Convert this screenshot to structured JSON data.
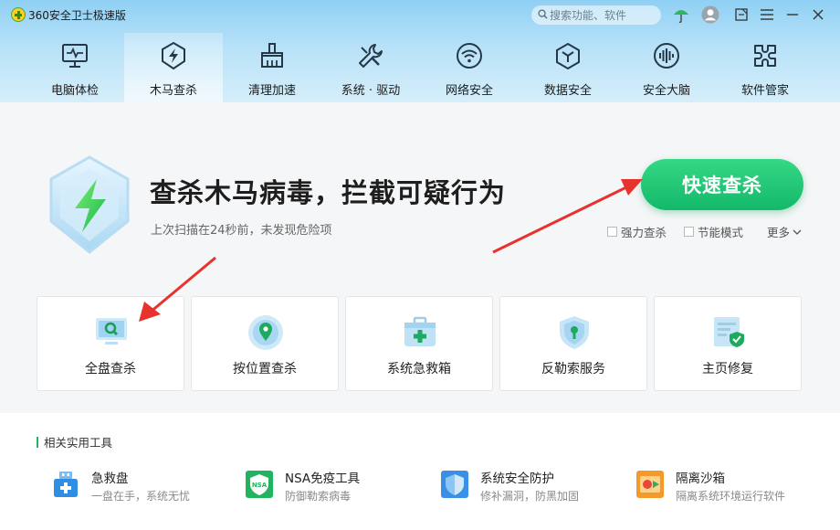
{
  "app": {
    "title": "360安全卫士极速版"
  },
  "search": {
    "placeholder": "搜索功能、软件"
  },
  "nav": {
    "tabs": [
      {
        "label": "电脑体检",
        "icon": "monitor-pulse-icon"
      },
      {
        "label": "木马查杀",
        "icon": "shield-bolt-icon"
      },
      {
        "label": "清理加速",
        "icon": "broom-icon"
      },
      {
        "label": "系统 · 驱动",
        "icon": "wrench-icon"
      },
      {
        "label": "网络安全",
        "icon": "wifi-icon"
      },
      {
        "label": "数据安全",
        "icon": "hexagon-icon"
      },
      {
        "label": "安全大脑",
        "icon": "brain-wave-icon"
      },
      {
        "label": "软件管家",
        "icon": "puzzle-icon"
      }
    ],
    "active_index": 1
  },
  "main": {
    "headline": "查杀木马病毒，拦截可疑行为",
    "subtext": "上次扫描在24秒前，未发现危险项",
    "quick_scan_label": "快速查杀",
    "options": {
      "power_scan": "强力查杀",
      "power_save": "节能模式",
      "more": "更多"
    }
  },
  "cards": [
    {
      "label": "全盘查杀",
      "icon": "monitor-search-icon"
    },
    {
      "label": "按位置查杀",
      "icon": "location-pin-icon"
    },
    {
      "label": "系统急救箱",
      "icon": "first-aid-kit-icon"
    },
    {
      "label": "反勒索服务",
      "icon": "shield-keyhole-icon"
    },
    {
      "label": "主页修复",
      "icon": "page-shield-icon"
    }
  ],
  "tools": {
    "title": "相关实用工具",
    "items": [
      {
        "name": "急救盘",
        "desc": "一盘在手，系统无忧",
        "icon": "usb-drive-icon"
      },
      {
        "name": "NSA免疫工具",
        "desc": "防御勒索病毒",
        "icon": "nsa-shield-icon",
        "badge": "NSA"
      },
      {
        "name": "系统安全防护",
        "desc": "修补漏洞，防黑加固",
        "icon": "blue-shield-icon"
      },
      {
        "name": "隔离沙箱",
        "desc": "隔离系统环境运行软件",
        "icon": "sandbox-icon"
      }
    ]
  },
  "colors": {
    "accent_green": "#21b466",
    "arrow_red": "#e8322e",
    "header_blue": "#8fd0f4"
  }
}
